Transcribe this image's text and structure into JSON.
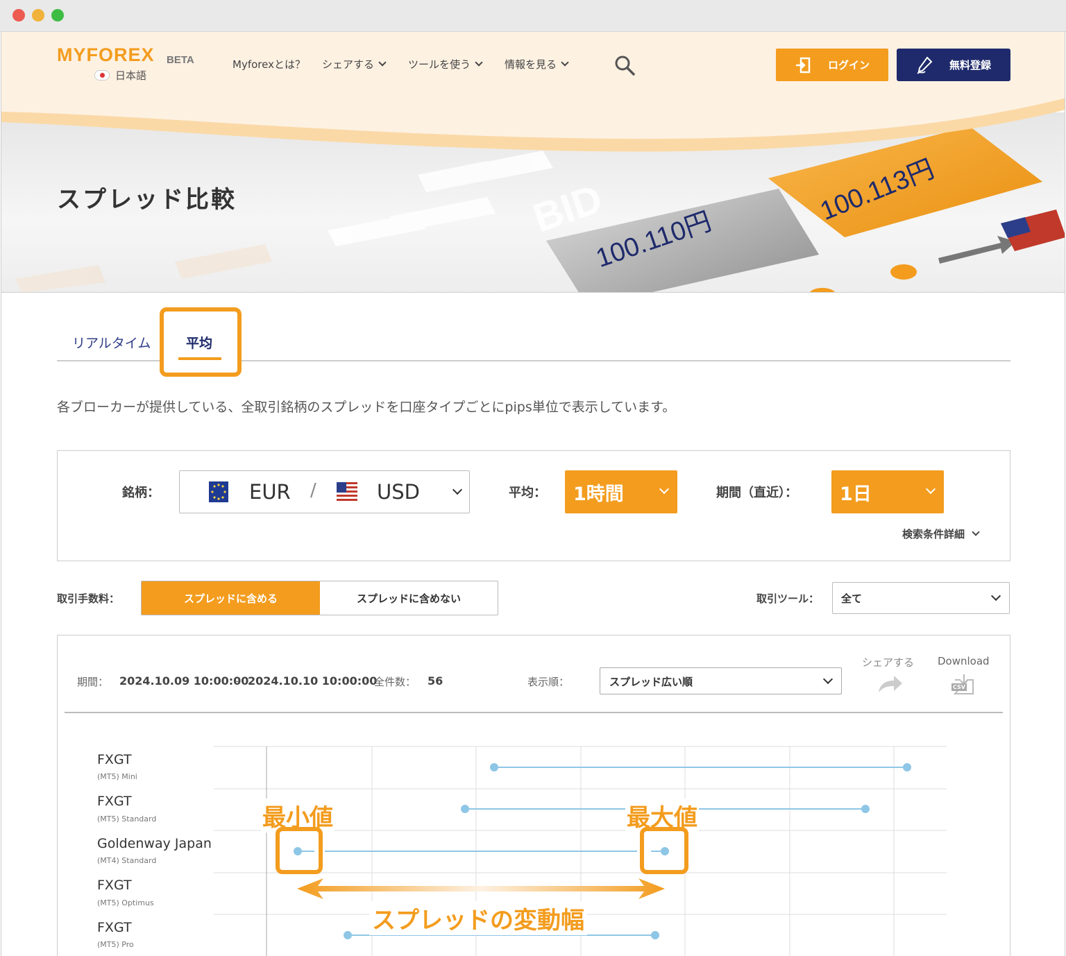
{
  "header": {
    "logo": "MYFOREX",
    "logo_badge": "BETA",
    "language": "日本語",
    "nav": [
      "Myforexとは？",
      "シェアする",
      "ツールを使う",
      "情報を見る"
    ],
    "login_label": "ログイン",
    "register_label": "無料登録"
  },
  "hero": {
    "title": "スプレッド比較",
    "bid_label": "BID",
    "bid_price": "100.110円",
    "ask_price": "100.113円"
  },
  "tabs": {
    "realtime": "リアルタイム",
    "average": "平均"
  },
  "description": "各ブローカーが提供している、全取引銘柄のスプレッドを口座タイプごとにpips単位で表示しています。",
  "filter": {
    "symbol_label": "銘柄：",
    "base": "EUR",
    "separator": "/",
    "quote": "USD",
    "average_label": "平均：",
    "average_value": "1時間",
    "period_label": "期間（直近）：",
    "period_value": "1日",
    "details_label": "検索条件詳細"
  },
  "options": {
    "commission_label": "取引手数料：",
    "include_label": "スプレッドに含める",
    "exclude_label": "スプレッドに含めない",
    "tool_label": "取引ツール：",
    "tool_value": "全て"
  },
  "results": {
    "period_label": "期間：",
    "period_start": "2024.10.09 10:00:00",
    "dash": "-",
    "period_end": "2024.10.10 10:00:00",
    "count_label": "全件数：",
    "count": "56",
    "sort_label": "表示順：",
    "sort_value": "スプレッド広い順",
    "share_label": "シェアする",
    "download_label": "Download",
    "csv_label": "CSV"
  },
  "rows": [
    {
      "broker": "FXGT",
      "account": "(MT5) Mini"
    },
    {
      "broker": "FXGT",
      "account": "(MT5) Standard"
    },
    {
      "broker": "Goldenway Japan",
      "account": "(MT4) Standard"
    },
    {
      "broker": "FXGT",
      "account": "(MT5) Optimus"
    },
    {
      "broker": "FXGT",
      "account": "(MT5) Pro"
    }
  ],
  "annotations": {
    "min": "最小値",
    "max": "最大値",
    "range": "スプレッドの変動幅"
  },
  "colors": {
    "accent": "#f39c1e",
    "navy": "#1e2a6b",
    "line": "#8ec6e6"
  }
}
